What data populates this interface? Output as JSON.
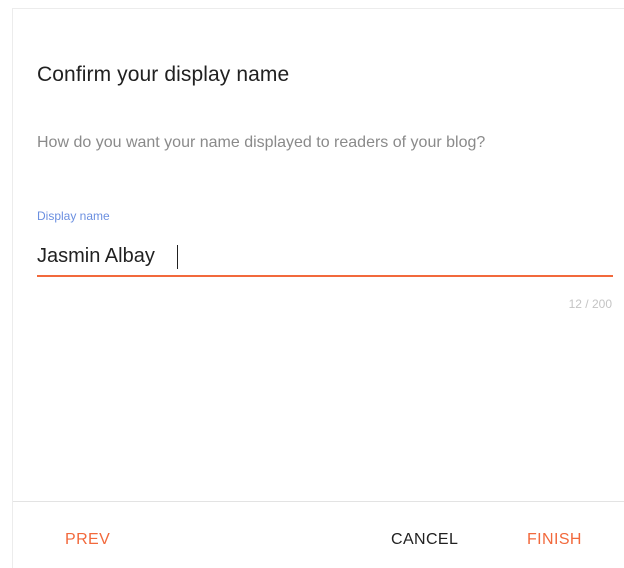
{
  "dialog": {
    "title": "Confirm your display name",
    "subtitle": "How do you want your name displayed to readers of your blog?",
    "field": {
      "label": "Display name",
      "value": "Jasmin Albay",
      "counter": "12 / 200"
    },
    "buttons": {
      "prev": "PREV",
      "cancel": "CANCEL",
      "finish": "FINISH"
    }
  },
  "colors": {
    "accent": "#f2693c",
    "label": "#6b8fe0",
    "text": "#212121",
    "muted": "#8a8a8a"
  }
}
